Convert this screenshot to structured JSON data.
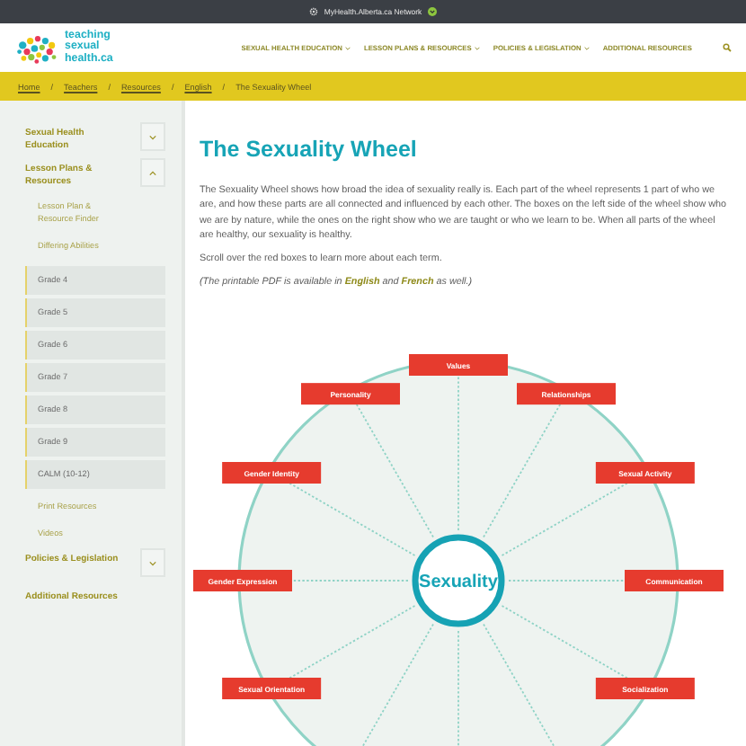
{
  "top_bar": {
    "network": "MyHealth.Alberta.ca Network"
  },
  "header": {
    "logo_text": [
      "teaching",
      "sexual",
      "health.ca"
    ],
    "nav": [
      {
        "label": "SEXUAL HEALTH EDUCATION",
        "dropdown": true
      },
      {
        "label": "LESSON PLANS & RESOURCES",
        "dropdown": true
      },
      {
        "label": "POLICIES & LEGISLATION",
        "dropdown": true
      },
      {
        "label": "ADDITIONAL RESOURCES",
        "dropdown": false
      }
    ]
  },
  "breadcrumb": [
    {
      "kind": "link",
      "label": "Home"
    },
    {
      "kind": "separator",
      "label": "/"
    },
    {
      "kind": "link",
      "label": "Teachers"
    },
    {
      "kind": "separator",
      "label": "/"
    },
    {
      "kind": "link",
      "label": "Resources"
    },
    {
      "kind": "separator",
      "label": "/"
    },
    {
      "kind": "link",
      "label": "English"
    },
    {
      "kind": "separator",
      "label": "/"
    },
    {
      "kind": "current",
      "label": "The Sexuality Wheel"
    }
  ],
  "sidebar": {
    "items": [
      {
        "label": "Sexual Health Education",
        "kind": "section",
        "expanded": false
      },
      {
        "label": "Lesson Plans & Resources",
        "kind": "section",
        "expanded": true
      },
      {
        "label": "Lesson Plan & Resource Finder",
        "kind": "sub"
      },
      {
        "label": "Differing Abilities",
        "kind": "sub"
      },
      {
        "label": "Grade 4",
        "kind": "grade"
      },
      {
        "label": "Grade 5",
        "kind": "grade"
      },
      {
        "label": "Grade 6",
        "kind": "grade"
      },
      {
        "label": "Grade 7",
        "kind": "grade"
      },
      {
        "label": "Grade 8",
        "kind": "grade"
      },
      {
        "label": "Grade 9",
        "kind": "grade"
      },
      {
        "label": "CALM (10-12)",
        "kind": "grade"
      },
      {
        "label": "Print Resources",
        "kind": "sub"
      },
      {
        "label": "Videos",
        "kind": "sub"
      },
      {
        "label": "Policies & Legislation",
        "kind": "section",
        "expanded": false
      },
      {
        "label": "Additional Resources",
        "kind": "link"
      }
    ]
  },
  "main": {
    "title": "The Sexuality Wheel",
    "intro": "The Sexuality Wheel shows how broad the idea of sexuality really is. Each part of the wheel represents 1 part of who we are, and how these parts are all connected and influenced by each other. The boxes on the left side of the wheel show who we are by nature, while the ones on the right show who we are taught or who we learn to be. When all parts of the wheel are healthy, our sexuality is healthy.",
    "hint": "Scroll over the red boxes to learn more about each term.",
    "pdf_note": [
      {
        "kind": "text",
        "text": "(The printable PDF is available in "
      },
      {
        "kind": "link",
        "text": "English"
      },
      {
        "kind": "text",
        "text": " and "
      },
      {
        "kind": "link",
        "text": "French"
      },
      {
        "kind": "text",
        "text": " as well.)"
      }
    ],
    "wheel": {
      "center": "Sexuality",
      "terms": [
        {
          "label": "Values"
        },
        {
          "label": "Relationships"
        },
        {
          "label": "Sexual Activity"
        },
        {
          "label": "Communication"
        },
        {
          "label": "Socialization"
        },
        {
          "label": "Sexual Orientation"
        },
        {
          "label": "Gender Expression"
        },
        {
          "label": "Gender Identity"
        },
        {
          "label": "Personality"
        }
      ]
    }
  }
}
